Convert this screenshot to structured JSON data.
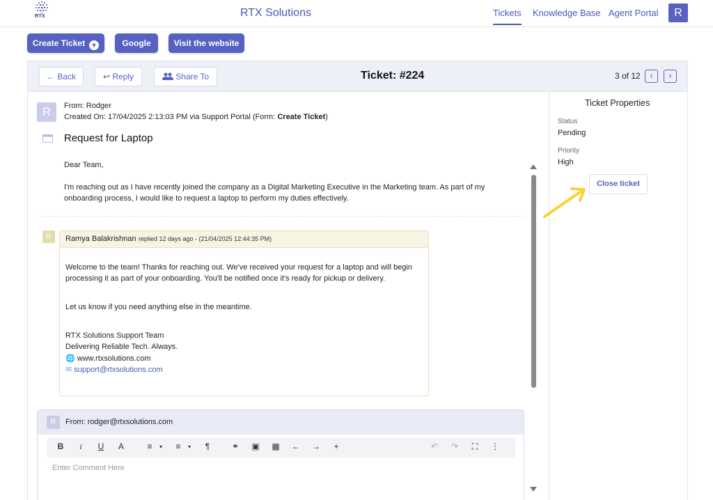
{
  "header": {
    "logo_text": "RTX",
    "app_title": "RTX Solutions",
    "nav": [
      "Tickets",
      "Knowledge Base",
      "Agent Portal"
    ],
    "user_initial": "R",
    "accent": "#5661c1"
  },
  "actions": {
    "create_ticket": "Create Ticket",
    "google": "Google",
    "visit": "Visit the website"
  },
  "ticket_bar": {
    "back": "Back",
    "reply": "Reply",
    "share": "Share To",
    "title": "Ticket: #224",
    "pager": "3 of 12"
  },
  "message": {
    "avatar": "R",
    "from": "From: Rodger",
    "created_prefix": "Created On: 17/04/2025 2:13:03 PM via Support Portal (Form: ",
    "form_name": "Create Ticket",
    "created_suffix": ")",
    "subject": "Request for Laptop",
    "greeting": "Dear Team,",
    "body_line1": "I'm reaching out as I have recently joined the company as a Digital Marketing Executive in the Marketing team. As part of my",
    "body_line2": "onboarding process, I would like to request a laptop to perform my duties effectively."
  },
  "reply": {
    "avatar": "R",
    "author": "Ramya Balakrishnan",
    "meta": "replied 12 days ago - (21/04/2025 12:44:35 PM)",
    "line1": "Welcome to the team! Thanks for reaching out. We've received your request for a laptop and will begin",
    "line2": "processing it as part of your onboarding. You'll be notified once it's ready for pickup or delivery.",
    "line3": "Let us know if you need anything else in the meantime.",
    "sig1": "RTX Solutions Support Team",
    "sig2": "Delivering Reliable Tech. Always.",
    "website": "www.rtxsolutions.com",
    "email": "support@rtxsolutions.com"
  },
  "compose": {
    "avatar": "R",
    "from": "From: rodger@rtxsolutions.com",
    "placeholder": "Enter Comment Here",
    "toolbar": [
      "B",
      "i",
      "U",
      "A",
      "≡",
      "▾",
      "≡",
      "▾",
      "¶",
      "⚭",
      "▣",
      "▦",
      "←",
      "→",
      "+",
      "↶",
      "↷",
      "⛶",
      "⋮"
    ]
  },
  "properties": {
    "title": "Ticket Properties",
    "status_label": "Status",
    "status_value": "Pending",
    "priority_label": "Priority",
    "priority_value": "High",
    "close_button": "Close ticket"
  }
}
